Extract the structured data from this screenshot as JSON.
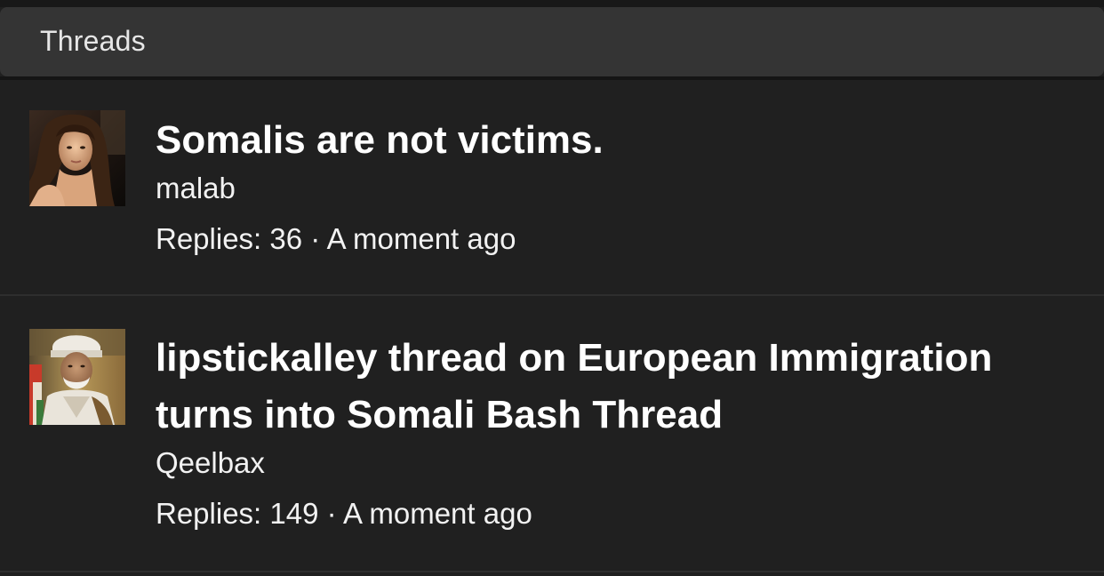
{
  "header": {
    "title": "Threads"
  },
  "threads": [
    {
      "title": "Somalis are not victims.",
      "author": "malab",
      "replies_label": "Replies:",
      "replies": "36",
      "separator": "·",
      "time": "A moment ago",
      "avatar": "woman-portrait-photo"
    },
    {
      "title": "lipstickalley thread on European Immigration turns into Somali Bash Thread",
      "author": "Qeelbax",
      "replies_label": "Replies:",
      "replies": "149",
      "separator": "·",
      "time": "A moment ago",
      "avatar": "man-in-turban-portrait-photo"
    }
  ],
  "colors": {
    "background": "#202020",
    "header_bg": "#343434",
    "text": "#ffffff"
  }
}
